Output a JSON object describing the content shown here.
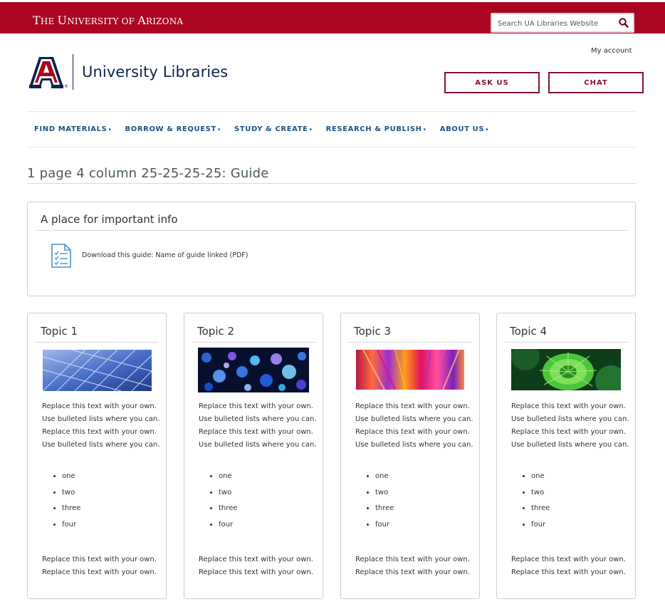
{
  "header": {
    "university_name": "The University of Arizona",
    "search_placeholder": "Search UA Libraries Website",
    "library_title": "University Libraries",
    "my_account": "My account",
    "ask_us": "ASK US",
    "chat": "CHAT"
  },
  "nav": {
    "items": [
      {
        "label": "FIND MATERIALS"
      },
      {
        "label": "BORROW & REQUEST"
      },
      {
        "label": "STUDY & CREATE"
      },
      {
        "label": "RESEARCH & PUBLISH"
      },
      {
        "label": "ABOUT US"
      }
    ]
  },
  "page": {
    "title": "1 page 4 column 25-25-25-25: Guide"
  },
  "info_box": {
    "title": "A place for important info",
    "download_text": "Download this guide: Name of guide linked (PDF)"
  },
  "cards": [
    {
      "title": "Topic 1",
      "text": "Replace this text with your own. Use bulleted lists where you can. Replace this text with your own. Use bulleted lists where you can.",
      "list": [
        "one",
        "two",
        "three",
        "four"
      ],
      "footer_line1": "Replace this text with your own.",
      "footer_line2": "Replace this text with your own.",
      "image_icon": "blue-glass-building-image"
    },
    {
      "title": "Topic 2",
      "text": "Replace this text with your own. Use bulleted lists where you can. Replace this text with your own. Use bulleted lists where you can.",
      "list": [
        "one",
        "two",
        "three",
        "four"
      ],
      "footer_line1": "Replace this text with your own.",
      "footer_line2": "Replace this text with your own.",
      "image_icon": "bokeh-lights-image"
    },
    {
      "title": "Topic 3",
      "text": "Replace this text with your own. Use bulleted lists where you can. Replace this text with your own. Use bulleted lists where you can.",
      "list": [
        "one",
        "two",
        "three",
        "four"
      ],
      "footer_line1": "Replace this text with your own.",
      "footer_line2": "Replace this text with your own.",
      "image_icon": "colorful-streaks-image"
    },
    {
      "title": "Topic 4",
      "text": "Replace this text with your own. Use bulleted lists where you can. Replace this text with your own. Use bulleted lists where you can.",
      "list": [
        "one",
        "two",
        "three",
        "four"
      ],
      "footer_line1": "Replace this text with your own.",
      "footer_line2": "Replace this text with your own.",
      "image_icon": "green-flower-image"
    }
  ],
  "colors": {
    "brand_red": "#ab0520",
    "navy": "#0c234b",
    "button_border": "#81132a",
    "nav_blue": "#1e5288"
  }
}
